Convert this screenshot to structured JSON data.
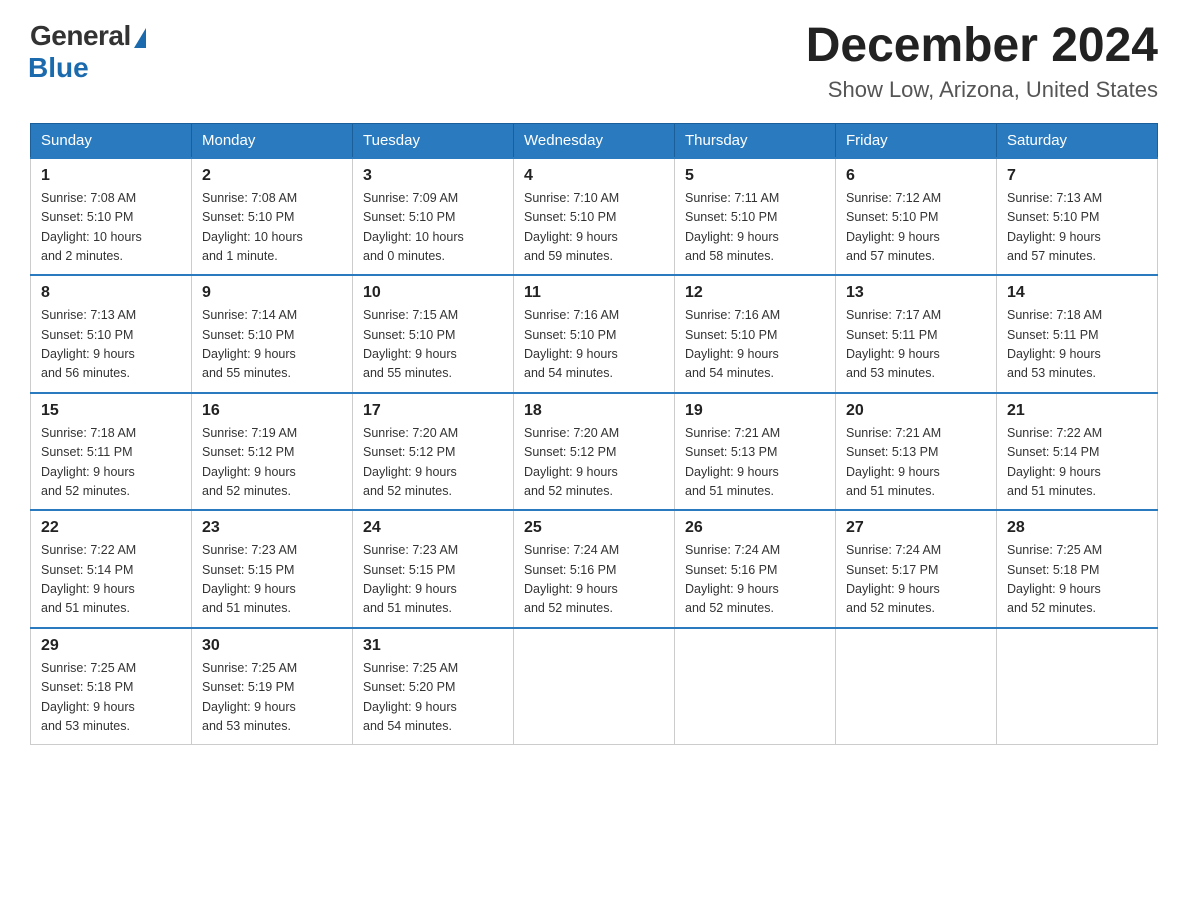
{
  "logo": {
    "general": "General",
    "blue": "Blue"
  },
  "header": {
    "month_year": "December 2024",
    "location": "Show Low, Arizona, United States"
  },
  "days_of_week": [
    "Sunday",
    "Monday",
    "Tuesday",
    "Wednesday",
    "Thursday",
    "Friday",
    "Saturday"
  ],
  "weeks": [
    [
      {
        "day": "1",
        "sunrise": "7:08 AM",
        "sunset": "5:10 PM",
        "daylight": "10 hours and 2 minutes."
      },
      {
        "day": "2",
        "sunrise": "7:08 AM",
        "sunset": "5:10 PM",
        "daylight": "10 hours and 1 minute."
      },
      {
        "day": "3",
        "sunrise": "7:09 AM",
        "sunset": "5:10 PM",
        "daylight": "10 hours and 0 minutes."
      },
      {
        "day": "4",
        "sunrise": "7:10 AM",
        "sunset": "5:10 PM",
        "daylight": "9 hours and 59 minutes."
      },
      {
        "day": "5",
        "sunrise": "7:11 AM",
        "sunset": "5:10 PM",
        "daylight": "9 hours and 58 minutes."
      },
      {
        "day": "6",
        "sunrise": "7:12 AM",
        "sunset": "5:10 PM",
        "daylight": "9 hours and 57 minutes."
      },
      {
        "day": "7",
        "sunrise": "7:13 AM",
        "sunset": "5:10 PM",
        "daylight": "9 hours and 57 minutes."
      }
    ],
    [
      {
        "day": "8",
        "sunrise": "7:13 AM",
        "sunset": "5:10 PM",
        "daylight": "9 hours and 56 minutes."
      },
      {
        "day": "9",
        "sunrise": "7:14 AM",
        "sunset": "5:10 PM",
        "daylight": "9 hours and 55 minutes."
      },
      {
        "day": "10",
        "sunrise": "7:15 AM",
        "sunset": "5:10 PM",
        "daylight": "9 hours and 55 minutes."
      },
      {
        "day": "11",
        "sunrise": "7:16 AM",
        "sunset": "5:10 PM",
        "daylight": "9 hours and 54 minutes."
      },
      {
        "day": "12",
        "sunrise": "7:16 AM",
        "sunset": "5:10 PM",
        "daylight": "9 hours and 54 minutes."
      },
      {
        "day": "13",
        "sunrise": "7:17 AM",
        "sunset": "5:11 PM",
        "daylight": "9 hours and 53 minutes."
      },
      {
        "day": "14",
        "sunrise": "7:18 AM",
        "sunset": "5:11 PM",
        "daylight": "9 hours and 53 minutes."
      }
    ],
    [
      {
        "day": "15",
        "sunrise": "7:18 AM",
        "sunset": "5:11 PM",
        "daylight": "9 hours and 52 minutes."
      },
      {
        "day": "16",
        "sunrise": "7:19 AM",
        "sunset": "5:12 PM",
        "daylight": "9 hours and 52 minutes."
      },
      {
        "day": "17",
        "sunrise": "7:20 AM",
        "sunset": "5:12 PM",
        "daylight": "9 hours and 52 minutes."
      },
      {
        "day": "18",
        "sunrise": "7:20 AM",
        "sunset": "5:12 PM",
        "daylight": "9 hours and 52 minutes."
      },
      {
        "day": "19",
        "sunrise": "7:21 AM",
        "sunset": "5:13 PM",
        "daylight": "9 hours and 51 minutes."
      },
      {
        "day": "20",
        "sunrise": "7:21 AM",
        "sunset": "5:13 PM",
        "daylight": "9 hours and 51 minutes."
      },
      {
        "day": "21",
        "sunrise": "7:22 AM",
        "sunset": "5:14 PM",
        "daylight": "9 hours and 51 minutes."
      }
    ],
    [
      {
        "day": "22",
        "sunrise": "7:22 AM",
        "sunset": "5:14 PM",
        "daylight": "9 hours and 51 minutes."
      },
      {
        "day": "23",
        "sunrise": "7:23 AM",
        "sunset": "5:15 PM",
        "daylight": "9 hours and 51 minutes."
      },
      {
        "day": "24",
        "sunrise": "7:23 AM",
        "sunset": "5:15 PM",
        "daylight": "9 hours and 51 minutes."
      },
      {
        "day": "25",
        "sunrise": "7:24 AM",
        "sunset": "5:16 PM",
        "daylight": "9 hours and 52 minutes."
      },
      {
        "day": "26",
        "sunrise": "7:24 AM",
        "sunset": "5:16 PM",
        "daylight": "9 hours and 52 minutes."
      },
      {
        "day": "27",
        "sunrise": "7:24 AM",
        "sunset": "5:17 PM",
        "daylight": "9 hours and 52 minutes."
      },
      {
        "day": "28",
        "sunrise": "7:25 AM",
        "sunset": "5:18 PM",
        "daylight": "9 hours and 52 minutes."
      }
    ],
    [
      {
        "day": "29",
        "sunrise": "7:25 AM",
        "sunset": "5:18 PM",
        "daylight": "9 hours and 53 minutes."
      },
      {
        "day": "30",
        "sunrise": "7:25 AM",
        "sunset": "5:19 PM",
        "daylight": "9 hours and 53 minutes."
      },
      {
        "day": "31",
        "sunrise": "7:25 AM",
        "sunset": "5:20 PM",
        "daylight": "9 hours and 54 minutes."
      },
      null,
      null,
      null,
      null
    ]
  ],
  "labels": {
    "sunrise": "Sunrise:",
    "sunset": "Sunset:",
    "daylight": "Daylight:"
  }
}
